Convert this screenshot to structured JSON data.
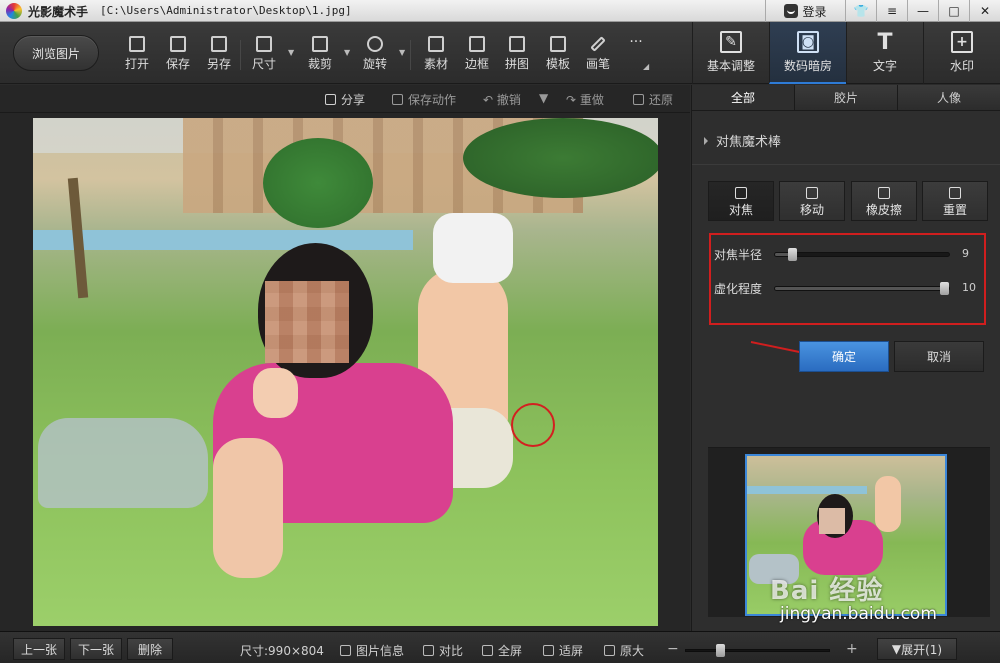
{
  "window": {
    "app_name": "光影魔术手",
    "file_path": "[C:\\Users\\Administrator\\Desktop\\1.jpg]",
    "login_label": "登录"
  },
  "toolbar": {
    "browse_label": "浏览图片",
    "tools": [
      {
        "label": "打开",
        "icon": "open-icon"
      },
      {
        "label": "保存",
        "icon": "save-icon"
      },
      {
        "label": "另存",
        "icon": "save-as-icon"
      },
      {
        "label": "尺寸",
        "icon": "resize-icon"
      },
      {
        "label": "裁剪",
        "icon": "crop-icon"
      },
      {
        "label": "旋转",
        "icon": "rotate-icon"
      },
      {
        "label": "素材",
        "icon": "material-icon"
      },
      {
        "label": "边框",
        "icon": "border-icon"
      },
      {
        "label": "拼图",
        "icon": "collage-icon"
      },
      {
        "label": "模板",
        "icon": "template-icon"
      },
      {
        "label": "画笔",
        "icon": "brush-icon"
      }
    ],
    "more_label": "···",
    "big_tabs": [
      {
        "label": "基本调整",
        "icon": "basic-adjust-icon"
      },
      {
        "label": "数码暗房",
        "icon": "darkroom-icon"
      },
      {
        "label": "文字",
        "icon": "text-icon",
        "glyph": "T"
      },
      {
        "label": "水印",
        "icon": "watermark-icon"
      }
    ],
    "active_big_tab": 1
  },
  "actions": {
    "share": "分享",
    "save_action": "保存动作",
    "undo": "撤销",
    "redo": "重做",
    "restore": "还原"
  },
  "panel": {
    "subtabs": [
      "全部",
      "胶片",
      "人像"
    ],
    "active_subtab": 0,
    "section_title": "对焦魔术棒",
    "modes": [
      "对焦",
      "移动",
      "橡皮擦",
      "重置"
    ],
    "active_mode": 0,
    "sliders": [
      {
        "label": "对焦半径",
        "value": "9",
        "fraction": 0.1
      },
      {
        "label": "虚化程度",
        "value": "10",
        "fraction": 0.97
      }
    ],
    "ok_label": "确定",
    "cancel_label": "取消",
    "highlight_color": "#d01e1e",
    "accent_color": "#2e7bd6"
  },
  "watermark": {
    "brand": "Bai 经验",
    "url": "jingyan.baidu.com"
  },
  "statusbar": {
    "prev": "上一张",
    "next": "下一张",
    "delete": "删除",
    "size_label": "尺寸:990×804",
    "info": "图片信息",
    "compare": "对比",
    "fullscreen": "全屏",
    "fit": "适屏",
    "original": "原大",
    "minus": "−",
    "plus": "+",
    "zoom_fraction": 0.24,
    "expand": "展开(1)"
  }
}
